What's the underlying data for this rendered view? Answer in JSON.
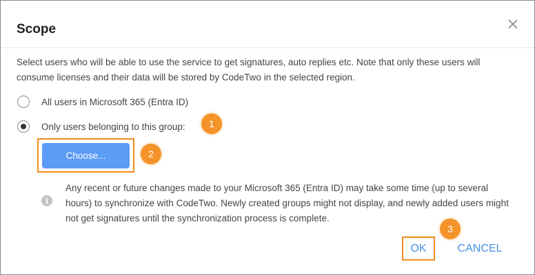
{
  "dialog": {
    "title": "Scope",
    "close_icon": "close-icon",
    "description": "Select users who will be able to use the service to get signatures, auto replies etc. Note that only these users will consume licenses and their data will be stored by CodeTwo in the selected region."
  },
  "options": [
    {
      "label": "All users in Microsoft 365 (Entra ID)",
      "checked": false
    },
    {
      "label": "Only users belonging to this group:",
      "checked": true
    }
  ],
  "choose_button": {
    "label": "Choose..."
  },
  "note": {
    "icon": "info-icon",
    "text": "Any recent or future changes made to your Microsoft 365 (Entra ID) may take some time (up to several hours) to synchronize with CodeTwo. Newly created groups might not display, and newly added users might not get signatures until the synchronization process is complete."
  },
  "footer": {
    "ok_label": "OK",
    "cancel_label": "CANCEL"
  },
  "badges": [
    "1",
    "2",
    "3"
  ],
  "colors": {
    "accent": "#4a90e2",
    "button_fill": "#5b9cf6",
    "highlight": "#f28c1d",
    "badge": "#f3932a"
  }
}
